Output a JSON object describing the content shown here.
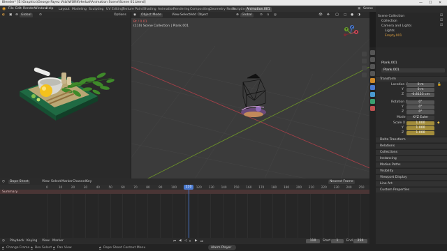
{
  "window": {
    "title": "Blender* [E:\\Graphics\\George Fayez Vidz\\WORK\\Herbal\\Animation Scene\\Scene 01.blend]",
    "minimize_glyph": "—",
    "maximize_glyph": "☐",
    "close_glyph": "✕"
  },
  "menu": {
    "logo": "◉",
    "items": [
      "File",
      "Edit",
      "Render",
      "Window",
      "Help"
    ],
    "workspaces": [
      "Layout",
      "Modeling",
      "Sculpting",
      "UV Editing",
      "Texture Paint",
      "Shading",
      "Animation",
      "Rendering",
      "Compositing",
      "Geometry Nodes",
      "Scripting",
      "Animation.001"
    ],
    "active_workspace": "Animation.001",
    "scene": "Scene",
    "view_layer": "ViewLayer"
  },
  "left_view": {
    "orientation": "Global",
    "options": "Options"
  },
  "viewport": {
    "mode": "Object Mode",
    "menu": [
      "View",
      "Select",
      "Add",
      "Object"
    ],
    "orientation": "Global",
    "options": "Options",
    "info_line1": "Bt / 0.01",
    "info_line2": "(110) Scene Collection | Plank.001",
    "gizmo_axes": [
      "X",
      "Y",
      "Z"
    ]
  },
  "outliner": {
    "items": [
      {
        "label": "Scene Collection",
        "indent": 0
      },
      {
        "label": "Collection",
        "indent": 1
      },
      {
        "label": "Camera and Lights",
        "indent": 1
      },
      {
        "label": "Lights",
        "indent": 2
      },
      {
        "label": "Empty.001",
        "indent": 2
      }
    ]
  },
  "properties": {
    "object_name": "Plank.001",
    "object_field": "Plank.001",
    "sections": {
      "transform": "Transform",
      "delta": "Delta Transform",
      "relations": "Relations",
      "collections": "Collections",
      "instancing": "Instancing",
      "motion_paths": "Motion Paths",
      "visibility": "Visibility",
      "viewport_display": "Viewport Display",
      "line_art": "Line Art",
      "custom_properties": "Custom Properties"
    },
    "location_label": "Location X",
    "location": [
      "0 m",
      "0 m",
      "-0.8153 cm"
    ],
    "rotation_label": "Rotation X",
    "rotation": [
      "0°",
      "0°",
      "0°"
    ],
    "mode_label": "Mode",
    "mode_value": "XYZ Euler",
    "scale_label": "Scale X",
    "scale": [
      "1.000",
      "1.000",
      "1.000"
    ],
    "axis_y": "Y",
    "axis_z": "Z"
  },
  "dopesheet": {
    "mode": "Dope Sheet",
    "menu": [
      "View",
      "Select",
      "Marker",
      "Channel",
      "Key"
    ],
    "nearest": "Nearest Frame",
    "summary": "Summary",
    "ruler": [
      "0",
      "10",
      "20",
      "30",
      "40",
      "50",
      "60",
      "70",
      "80",
      "90",
      "100",
      "110",
      "120",
      "130",
      "140",
      "150",
      "160",
      "170",
      "180",
      "190",
      "200",
      "210",
      "220",
      "230",
      "240",
      "250"
    ],
    "current_frame": "110"
  },
  "timeline": {
    "menu": [
      "Playback",
      "Keying",
      "View",
      "Marker"
    ],
    "current": "110",
    "start_label": "Start",
    "start": "1",
    "end_label": "End",
    "end": "250"
  },
  "status": {
    "left1": "Change Frame",
    "left2": "Box Select",
    "left3": "Pan View",
    "mid": "Dope Sheet Context Menu",
    "tooltip": "Alarm Player"
  }
}
